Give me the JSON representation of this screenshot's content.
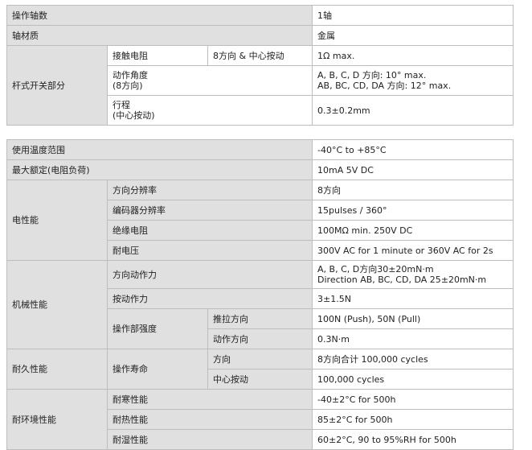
{
  "table1": {
    "rows": [
      {
        "label": "操作轴数",
        "value": "1轴"
      },
      {
        "label": "轴材质",
        "value": "金属"
      }
    ],
    "lever_group": "杆式开关部分",
    "contact_resistance": {
      "label": "接触电阻",
      "sublabel": "8方向 & 中心按动",
      "value": "1Ω  max."
    },
    "operating_angle": {
      "label_line1": "动作角度",
      "label_line2": "(8方向)",
      "value_line1": "A, B, C, D 方向: 10°  max.",
      "value_line2": "AB, BC, CD, DA 方向: 12°  max."
    },
    "travel": {
      "label_line1": "行程",
      "label_line2": "(中心按动)",
      "value": "0.3±0.2mm"
    }
  },
  "table2": {
    "temp_range": {
      "label": "使用温度范围",
      "value": "-40°C to +85°C"
    },
    "max_rating": {
      "label": "最大额定(电阻负荷)",
      "value": "10mA 5V DC"
    },
    "electrical": {
      "group": "电性能",
      "rows": [
        {
          "label": "方向分辨率",
          "value": "8方向"
        },
        {
          "label": "编码器分辨率",
          "value": "15pulses / 360°"
        },
        {
          "label": "绝缘电阻",
          "value": "100MΩ  min. 250V DC"
        },
        {
          "label": "耐电压",
          "value": "300V AC for 1 minute or 360V AC for 2s"
        }
      ]
    },
    "mechanical": {
      "group": "机械性能",
      "operating_force": {
        "label": "方向动作力",
        "value_line1": "A, B, C, D方向30±20mN·m",
        "value_line2": "Direction AB, BC, CD, DA 25±20mN·m"
      },
      "push_force": {
        "label": "按动作力",
        "value": "3±1.5N"
      },
      "strength": {
        "label": "操作部强度",
        "push_pull": {
          "label": "推拉方向",
          "value": "100N (Push), 50N (Pull)"
        },
        "action_dir": {
          "label": "动作方向",
          "value": "0.3N·m"
        }
      }
    },
    "durability": {
      "group": "耐久性能",
      "life_label": "操作寿命",
      "direction": {
        "label": "方向",
        "value": "8方向合计 100,000 cycles"
      },
      "center": {
        "label": "中心按动",
        "value": "100,000 cycles"
      }
    },
    "environmental": {
      "group": "耐环境性能",
      "rows": [
        {
          "label": "耐寒性能",
          "value": "-40±2°C for 500h"
        },
        {
          "label": "耐热性能",
          "value": "85±2°C for 500h"
        },
        {
          "label": "耐湿性能",
          "value": "60±2°C, 90 to 95%RH for 500h"
        }
      ]
    }
  }
}
